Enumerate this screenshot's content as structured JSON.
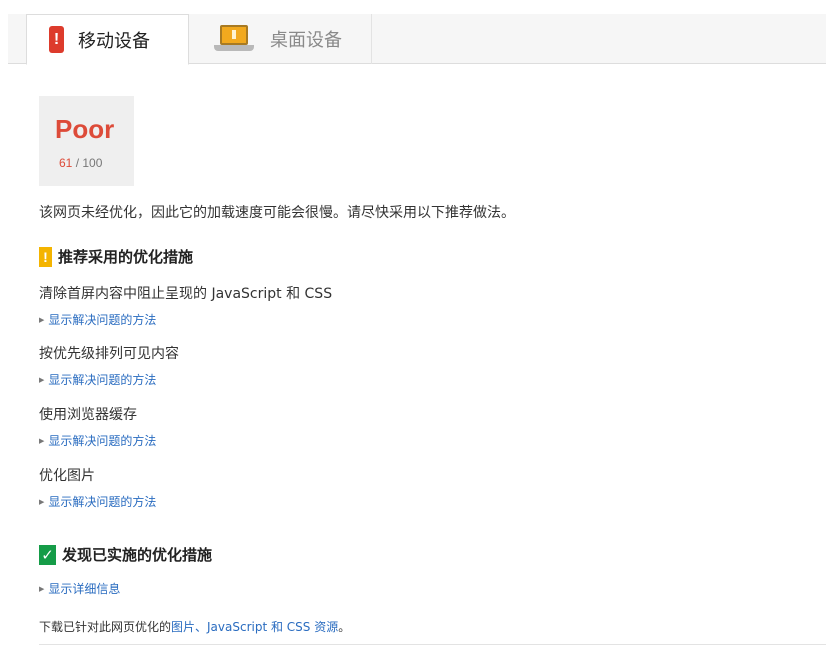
{
  "tabs": {
    "mobile": {
      "label": "移动设备",
      "icon": "phone-alert-icon",
      "active": true
    },
    "desktop": {
      "label": "桌面设备",
      "icon": "laptop-icon",
      "active": false
    }
  },
  "score": {
    "rating": "Poor",
    "value": "61",
    "max": "/ 100",
    "color": "#dd4b39"
  },
  "summary": "该网页未经优化，因此它的加载速度可能会很慢。请尽快采用以下推荐做法。",
  "recommended": {
    "title": "推荐采用的优化措施",
    "icon": "warning-icon",
    "color": "#f4b400",
    "rules": [
      {
        "title": "清除首屏内容中阻止呈现的 JavaScript 和 CSS",
        "link": "显示解决问题的方法"
      },
      {
        "title": "按优先级排列可见内容",
        "link": "显示解决问题的方法"
      },
      {
        "title": "使用浏览器缓存",
        "link": "显示解决问题的方法"
      },
      {
        "title": "优化图片",
        "link": "显示解决问题的方法"
      }
    ]
  },
  "passed": {
    "title": "发现已实施的优化措施",
    "icon": "check-icon",
    "color": "#159c48",
    "link": "显示详细信息"
  },
  "footer": {
    "prefix": "下载已针对此网页优化的",
    "link": "图片、JavaScript 和 CSS 资源",
    "suffix": "。"
  }
}
